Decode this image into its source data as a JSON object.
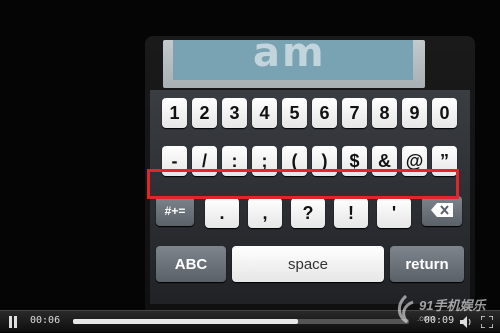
{
  "screen": {
    "text": "am"
  },
  "keyboard": {
    "row1": [
      "1",
      "2",
      "3",
      "4",
      "5",
      "6",
      "7",
      "8",
      "9",
      "0"
    ],
    "row2": [
      "-",
      "/",
      ":",
      ";",
      "(",
      ")",
      "$",
      "&",
      "@",
      "”"
    ],
    "row3_left": "#+=",
    "row3_keys": [
      ".",
      ",",
      "?",
      "!",
      "'"
    ],
    "row4": {
      "abc": "ABC",
      "space": "space",
      "return": "return"
    }
  },
  "player": {
    "current_time": "00:06",
    "duration": "00:09",
    "progress_fraction": 0.67
  },
  "watermark": {
    "brand": "91手机娱乐",
    "sub": ".com"
  },
  "colors": {
    "highlight": "#e2252b",
    "key": "#ffffff",
    "key_dark": "#6c737a"
  }
}
